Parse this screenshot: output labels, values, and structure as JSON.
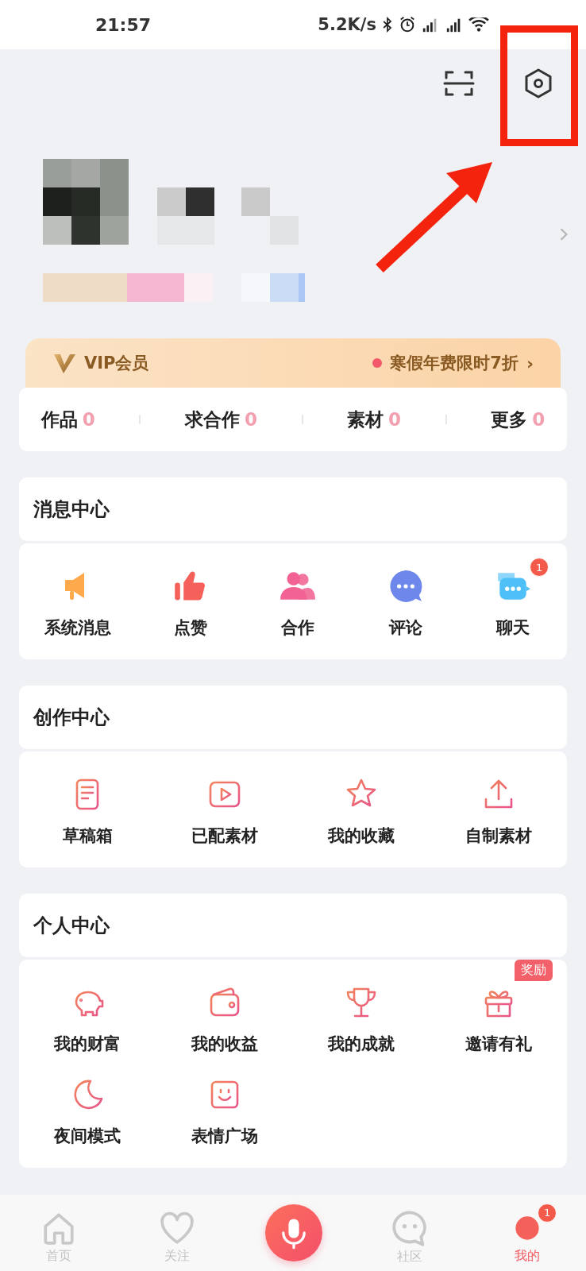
{
  "status_bar": {
    "time": "21:57",
    "speed": "5.2K/s"
  },
  "vip": {
    "title": "VIP会员",
    "promo": "寒假年费限时7折",
    "chevron": "›"
  },
  "stats": [
    {
      "label": "作品",
      "count": "0"
    },
    {
      "label": "求合作",
      "count": "0"
    },
    {
      "label": "素材",
      "count": "0"
    },
    {
      "label": "更多",
      "count": "0"
    }
  ],
  "sections": [
    {
      "title": "消息中心",
      "kind": "message",
      "items": [
        {
          "label": "系统消息"
        },
        {
          "label": "点赞"
        },
        {
          "label": "合作"
        },
        {
          "label": "评论"
        },
        {
          "label": "聊天",
          "badge": "1"
        }
      ]
    },
    {
      "title": "创作中心",
      "kind": "tool",
      "items": [
        {
          "label": "草稿箱"
        },
        {
          "label": "已配素材"
        },
        {
          "label": "我的收藏"
        },
        {
          "label": "自制素材"
        }
      ]
    },
    {
      "title": "个人中心",
      "kind": "personal",
      "items": [
        {
          "label": "我的财富"
        },
        {
          "label": "我的收益"
        },
        {
          "label": "我的成就"
        },
        {
          "label": "邀请有礼",
          "tag": "奖励"
        },
        {
          "label": "夜间模式"
        },
        {
          "label": "表情广场"
        }
      ]
    }
  ],
  "nav": [
    {
      "label": "首页",
      "kind": "tab",
      "selected": false
    },
    {
      "label": "关注",
      "kind": "tab",
      "selected": false
    },
    {
      "kind": "record"
    },
    {
      "label": "社区",
      "kind": "tab",
      "selected": false
    },
    {
      "label": "我的",
      "kind": "tab",
      "selected": true,
      "badge": "1"
    }
  ]
}
